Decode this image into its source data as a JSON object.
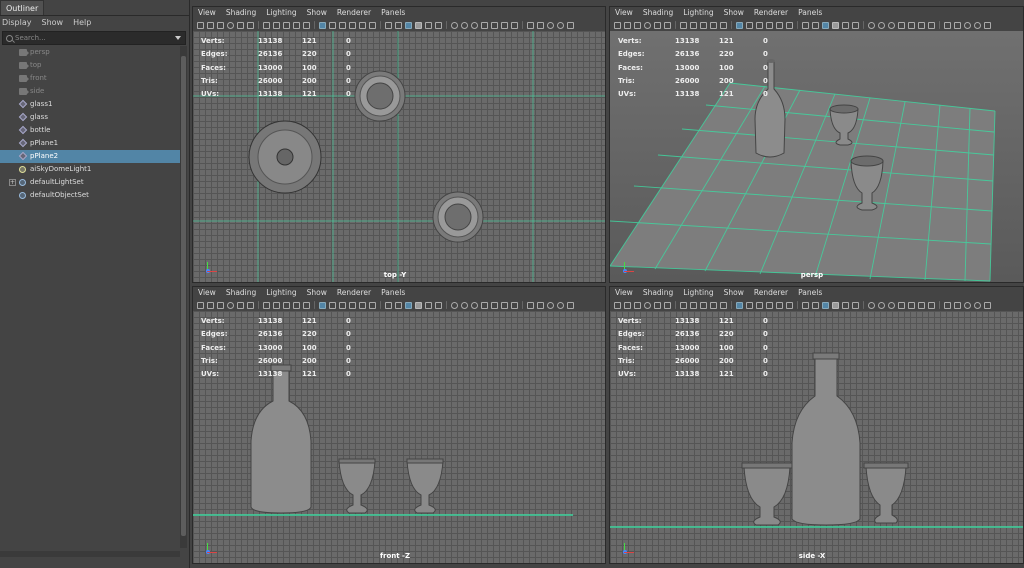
{
  "outliner": {
    "tab": "Outliner",
    "menu": [
      "Display",
      "Show",
      "Help"
    ],
    "search_placeholder": "Search...",
    "items": [
      {
        "label": "persp",
        "type": "camera"
      },
      {
        "label": "top",
        "type": "camera"
      },
      {
        "label": "front",
        "type": "camera"
      },
      {
        "label": "side",
        "type": "camera"
      },
      {
        "label": "glass1",
        "type": "mesh"
      },
      {
        "label": "glass",
        "type": "mesh"
      },
      {
        "label": "bottle",
        "type": "mesh"
      },
      {
        "label": "pPlane1",
        "type": "mesh"
      },
      {
        "label": "pPlane2",
        "type": "mesh",
        "selected": true
      },
      {
        "label": "aiSkyDomeLight1",
        "type": "light"
      },
      {
        "label": "defaultLightSet",
        "type": "set",
        "expandable": true
      },
      {
        "label": "defaultObjectSet",
        "type": "set"
      }
    ]
  },
  "viewport_menu": [
    "View",
    "Shading",
    "Lighting",
    "Show",
    "Renderer",
    "Panels"
  ],
  "hud": {
    "rows": [
      {
        "label": "Verts:",
        "a": "13138",
        "b": "121",
        "c": "0"
      },
      {
        "label": "Edges:",
        "a": "26136",
        "b": "220",
        "c": "0"
      },
      {
        "label": "Faces:",
        "a": "13000",
        "b": "100",
        "c": "0"
      },
      {
        "label": "Tris:",
        "a": "26000",
        "b": "200",
        "c": "0"
      },
      {
        "label": "UVs:",
        "a": "13138",
        "b": "121",
        "c": "0"
      }
    ]
  },
  "viewports": {
    "top": {
      "label": "top -Y"
    },
    "persp": {
      "label": "persp"
    },
    "front": {
      "label": "front -Z"
    },
    "side": {
      "label": "side -X"
    }
  },
  "colors": {
    "accent": "#5285a6",
    "grid_axis": "#3fd6a0",
    "mesh": "#8a8a8a"
  }
}
